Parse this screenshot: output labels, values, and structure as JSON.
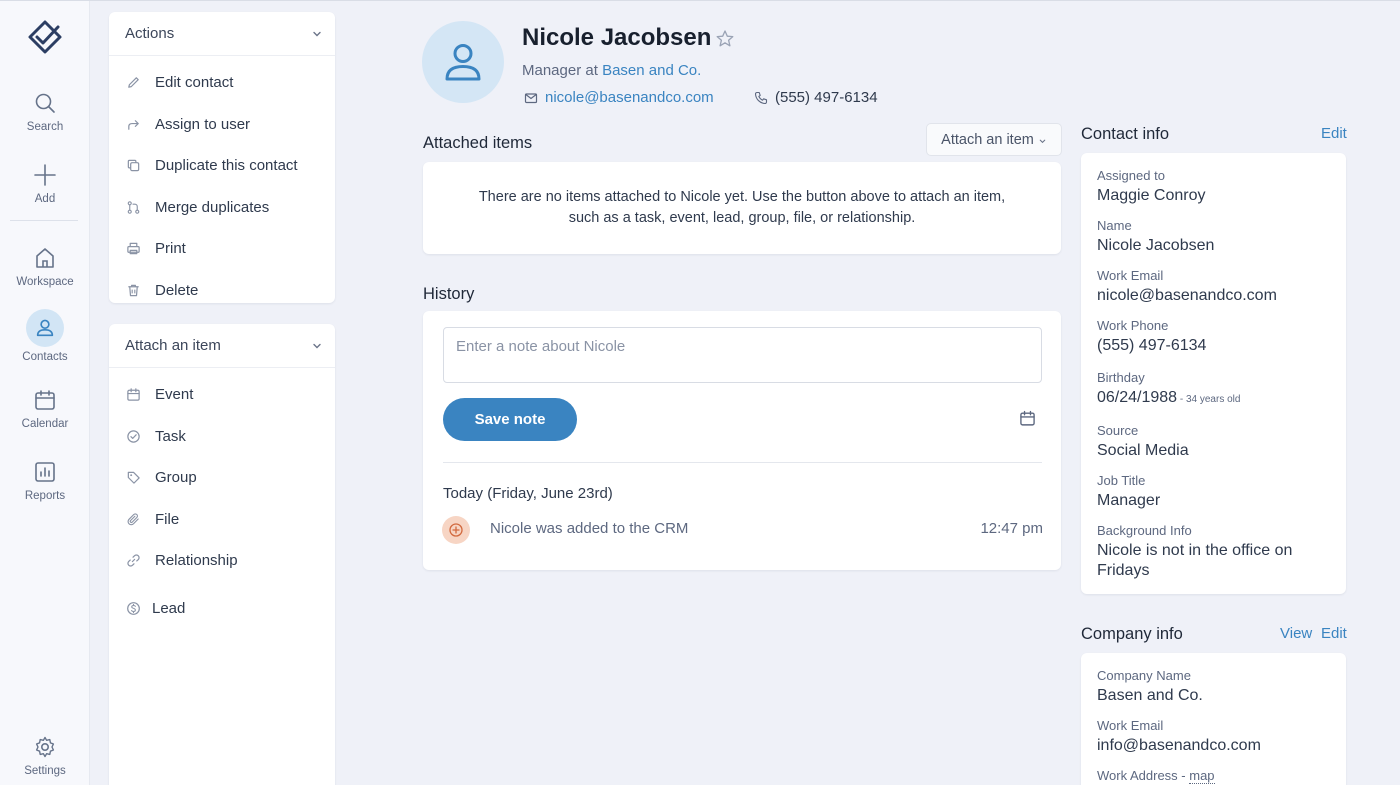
{
  "nav": {
    "items": [
      {
        "label": "Search",
        "icon": "search-icon"
      },
      {
        "label": "Add",
        "icon": "plus-icon"
      },
      {
        "label": "Workspace",
        "icon": "home-icon"
      },
      {
        "label": "Contacts",
        "icon": "user-icon",
        "active": true
      },
      {
        "label": "Calendar",
        "icon": "calendar-icon"
      },
      {
        "label": "Reports",
        "icon": "chart-icon"
      },
      {
        "label": "Settings",
        "icon": "gear-icon"
      }
    ]
  },
  "actions_panel": {
    "title": "Actions",
    "items": [
      {
        "label": "Edit contact",
        "icon": "pencil-icon"
      },
      {
        "label": "Assign to user",
        "icon": "share-arrow-icon"
      },
      {
        "label": "Duplicate this contact",
        "icon": "copy-icon"
      },
      {
        "label": "Merge duplicates",
        "icon": "merge-icon"
      },
      {
        "label": "Print",
        "icon": "printer-icon"
      },
      {
        "label": "Delete",
        "icon": "trash-icon"
      }
    ]
  },
  "attach_panel": {
    "title": "Attach an item",
    "items": [
      {
        "label": "Event",
        "icon": "calendar-icon"
      },
      {
        "label": "Task",
        "icon": "check-circle-icon"
      },
      {
        "label": "Group",
        "icon": "tag-icon"
      },
      {
        "label": "File",
        "icon": "paperclip-icon"
      },
      {
        "label": "Relationship",
        "icon": "link-icon"
      },
      {
        "label": "Lead",
        "icon": "dollar-circle-icon"
      }
    ]
  },
  "contact": {
    "name": "Nicole Jacobsen",
    "subtitle_prefix": "Manager at",
    "company": "Basen and Co.",
    "email": "nicole@basenandco.com",
    "phone": "(555) 497-6134"
  },
  "attached_items": {
    "title": "Attached items",
    "button_label": "Attach an item",
    "empty_line1": "There are no items attached to Nicole yet. Use the button above to attach an item,",
    "empty_line2": "such as a task, event, lead, group, file, or relationship."
  },
  "history": {
    "title": "History",
    "note_placeholder": "Enter a note about Nicole",
    "save_label": "Save note",
    "day_label": "Today (Friday, June 23rd)",
    "entries": [
      {
        "text": "Nicole was added to the CRM",
        "time": "12:47 pm"
      }
    ]
  },
  "contact_info": {
    "title": "Contact info",
    "edit_label": "Edit",
    "fields": [
      {
        "label": "Assigned to",
        "value": "Maggie Conroy"
      },
      {
        "label": "Name",
        "value": "Nicole Jacobsen"
      },
      {
        "label": "Work Email",
        "value": "nicole@basenandco.com"
      },
      {
        "label": "Work Phone",
        "value": "(555) 497-6134"
      },
      {
        "label": "Birthday",
        "value": "06/24/1988",
        "note": " - 34 years old"
      },
      {
        "label": "Source",
        "value": "Social Media"
      },
      {
        "label": "Job Title",
        "value": "Manager"
      },
      {
        "label": "Background Info",
        "value_line1": "Nicole is not in the office on",
        "value_line2": "Fridays"
      }
    ]
  },
  "company_info": {
    "title": "Company info",
    "view_label": "View",
    "edit_label": "Edit",
    "fields": [
      {
        "label": "Company Name",
        "value": "Basen and Co."
      },
      {
        "label": "Work Email",
        "value": "info@basenandco.com"
      },
      {
        "label": "Work Address",
        "separator": " - ",
        "link": "map"
      }
    ]
  },
  "colors": {
    "accent": "#3a84c1",
    "background": "#eff1f8",
    "avatar_bg": "#d4e6f5",
    "history_icon_bg": "#f7d5c4"
  }
}
